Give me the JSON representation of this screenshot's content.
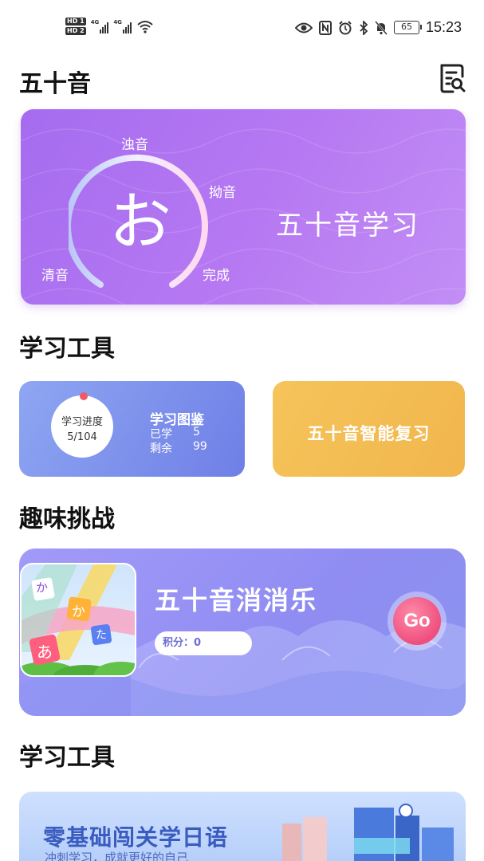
{
  "status_bar": {
    "hd1": "HD 1",
    "hd2": "HD 2",
    "net1": "4G",
    "net2": "4G",
    "battery": "65",
    "time": "15:23"
  },
  "header": {
    "title": "五十音",
    "search_icon": "search-doc-icon"
  },
  "hero": {
    "kana": "お",
    "labels": {
      "seion": "清音",
      "dakuon": "浊音",
      "youon": "拗音",
      "done": "完成"
    },
    "title": "五十音学习",
    "accent": "#a56cf0"
  },
  "tools_section": {
    "title": "学习工具",
    "progress": {
      "label": "学习进度",
      "value": "5/104"
    },
    "dex": {
      "title": "学习图鉴",
      "learned_label": "已学",
      "learned_value": "5",
      "remaining_label": "剩余",
      "remaining_value": "99"
    },
    "review": {
      "label": "五十音智能复习",
      "color": "#f5c45a"
    }
  },
  "challenge_section": {
    "title": "趣味挑战",
    "game": {
      "title": "五十音消消乐",
      "score": "积分：0",
      "go": "Go",
      "tiles": [
        "か",
        "か",
        "た",
        "あ"
      ]
    }
  },
  "tools_section2": {
    "title": "学习工具",
    "banner": {
      "title": "零基础闯关学日语",
      "subtitle": "冲刺学习，成就更好的自己"
    }
  }
}
